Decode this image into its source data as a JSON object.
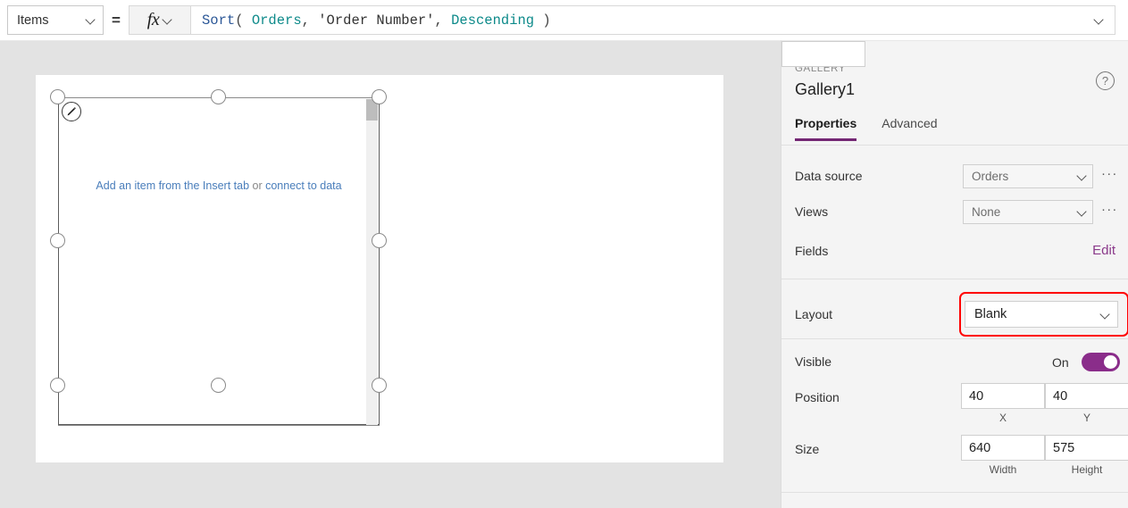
{
  "formula_bar": {
    "property_dropdown": {
      "value": "Items",
      "chevron": "chevron-down-icon"
    },
    "equals": "=",
    "fx_label": "fx",
    "formula_tokens": [
      {
        "text": "Sort",
        "type": "fn"
      },
      {
        "text": "( ",
        "type": "punct"
      },
      {
        "text": "Orders",
        "type": "src"
      },
      {
        "text": ", ",
        "type": "punct"
      },
      {
        "text": "'Order Number'",
        "type": "str"
      },
      {
        "text": ", ",
        "type": "punct"
      },
      {
        "text": "Descending",
        "type": "enum"
      },
      {
        "text": " )",
        "type": "punct"
      }
    ],
    "formula_plain": "Sort( Orders, 'Order Number', Descending )",
    "expand_chevron": "chevron-down-icon"
  },
  "canvas": {
    "placeholder_link_1": "Add an item from the Insert tab",
    "placeholder_separator": " or ",
    "placeholder_link_2": "connect to data",
    "edit_badge_icon": "pencil-icon"
  },
  "panel": {
    "kicker": "GALLERY",
    "title": "Gallery1",
    "help_icon": "help-circle-icon",
    "tabs": [
      {
        "label": "Properties",
        "active": true
      },
      {
        "label": "Advanced",
        "active": false
      }
    ],
    "rows": {
      "data_source": {
        "label": "Data source",
        "value": "Orders",
        "more": "···"
      },
      "views": {
        "label": "Views",
        "value": "None",
        "more": "···"
      },
      "fields": {
        "label": "Fields",
        "action": "Edit"
      },
      "layout": {
        "label": "Layout",
        "value": "Blank",
        "highlighted": true
      },
      "visible": {
        "label": "Visible",
        "state": "On"
      },
      "position": {
        "label": "Position",
        "x_value": "40",
        "x_sublabel": "X",
        "y_value": "40",
        "y_sublabel": "Y"
      },
      "size": {
        "label": "Size",
        "width_value": "640",
        "width_sublabel": "Width",
        "height_value": "575",
        "height_sublabel": "Height"
      }
    }
  },
  "colors": {
    "accent_purple": "#742774",
    "toggle_on": "#8a2d8a",
    "annotation_red": "#ff0000",
    "link_blue": "#4a7ebb",
    "formula_fn": "#2b5797",
    "formula_source": "#0d8a8a"
  }
}
